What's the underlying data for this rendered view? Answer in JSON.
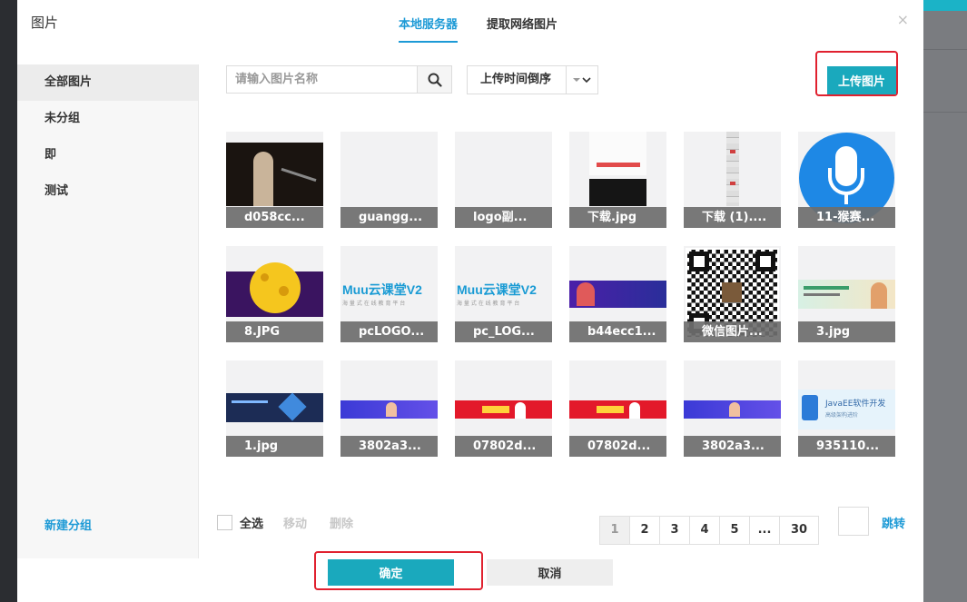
{
  "dialog": {
    "title": "图片",
    "close_glyph": "×",
    "tabs": [
      {
        "label": "本地服务器",
        "active": true
      },
      {
        "label": "提取网络图片",
        "active": false
      }
    ]
  },
  "sidebar": {
    "items": [
      {
        "label": "全部图片",
        "active": true
      },
      {
        "label": "未分组"
      },
      {
        "label": "即"
      },
      {
        "label": "测试"
      }
    ],
    "new_group": "新建分组"
  },
  "toolbar": {
    "search_placeholder": "请输入图片名称",
    "search_icon": "search-icon",
    "sort_label": "上传时间倒序",
    "upload_label": "上传图片"
  },
  "images": [
    {
      "caption": "d058cc...",
      "art": "photo-dark"
    },
    {
      "caption": "guangg...",
      "art": "blank"
    },
    {
      "caption": "logo副...",
      "art": "blank"
    },
    {
      "caption": "下载.jpg",
      "art": "poster"
    },
    {
      "caption": "下载 (1)....",
      "art": "ruler"
    },
    {
      "caption": "11-猴赛...",
      "art": "mic"
    },
    {
      "caption": "8.JPG",
      "art": "planet"
    },
    {
      "caption": "pcLOGO...",
      "art": "logo"
    },
    {
      "caption": "pc_LOG...",
      "art": "logo"
    },
    {
      "caption": "b44ecc1...",
      "art": "banner-purple"
    },
    {
      "caption": "微信图片...",
      "art": "qr"
    },
    {
      "caption": "3.jpg",
      "art": "banner-green"
    },
    {
      "caption": "1.jpg",
      "art": "banner-navy"
    },
    {
      "caption": "3802a3...",
      "art": "banner-blue"
    },
    {
      "caption": "07802d...",
      "art": "banner-red"
    },
    {
      "caption": "07802d...",
      "art": "banner-red"
    },
    {
      "caption": "3802a3...",
      "art": "banner-blue"
    },
    {
      "caption": "935110...",
      "art": "javaee"
    }
  ],
  "art_text": {
    "logo_main": "Muu云课堂V2",
    "logo_sub": "海 量 式 在 线 教 育 平 台",
    "javaee_main": "JavaEE软件开发",
    "javaee_sub": "高级架构进阶"
  },
  "footer": {
    "select_all": "全选",
    "move": "移动",
    "delete": "删除",
    "pages": [
      "1",
      "2",
      "3",
      "4",
      "5",
      "...",
      "30"
    ],
    "current_page": "1",
    "jump": "跳转",
    "confirm": "确定",
    "cancel": "取消"
  },
  "colors": {
    "accent": "#1d9ad6",
    "button": "#1aa9bd",
    "highlight": "#e0212f"
  }
}
